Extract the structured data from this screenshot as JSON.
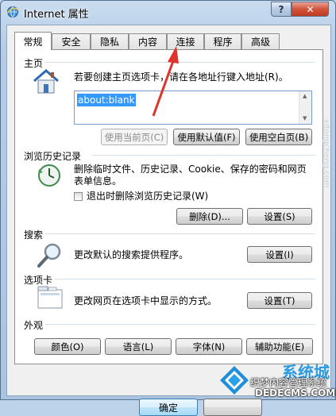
{
  "window": {
    "title": "Internet 属性",
    "help_label": "?",
    "close_label": "✕"
  },
  "tabs": [
    {
      "label": "常规",
      "active": true
    },
    {
      "label": "安全"
    },
    {
      "label": "隐私"
    },
    {
      "label": "内容"
    },
    {
      "label": "连接"
    },
    {
      "label": "程序"
    },
    {
      "label": "高级"
    }
  ],
  "homepage": {
    "section_label": "主页",
    "description": "若要创建主页选项卡，请在各地址行键入地址(R)。",
    "url": "about:blank",
    "buttons": {
      "use_current": "使用当前页(C)",
      "use_default": "使用默认值(F)",
      "use_blank": "使用空白页(B)"
    }
  },
  "history": {
    "section_label": "浏览历史记录",
    "description_line1": "删除临时文件、历史记录、Cookie、保存的密码和网页",
    "description_line2": "表单信息。",
    "checkbox_label": "退出时删除浏览历史记录(W)",
    "checkbox_checked": false,
    "delete_button": "删除(D)...",
    "settings_button": "设置(S)"
  },
  "search": {
    "section_label": "搜索",
    "description": "更改默认的搜索提供程序。",
    "settings_button": "设置(I)"
  },
  "tabs_section": {
    "section_label": "选项卡",
    "description": "更改网页在选项卡中显示的方式。",
    "settings_button": "设置(T)"
  },
  "appearance": {
    "section_label": "外观",
    "buttons": {
      "colors": "颜色(O)",
      "languages": "语言(L)",
      "fonts": "字体(N)",
      "accessibility": "辅助功能(E)"
    }
  },
  "footer": {
    "ok_button": "确定"
  },
  "watermark": {
    "brand_text": "系统城",
    "line1": "织梦内容管理系统",
    "line2": "DEDECMS.COM",
    "corner_text": "xitongcheng.com"
  },
  "colors": {
    "annotation_arrow": "#e0332b",
    "selection": "#3399ff"
  }
}
